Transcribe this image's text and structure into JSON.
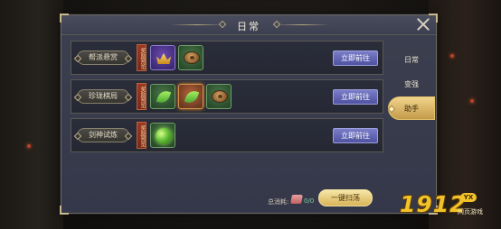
{
  "window": {
    "title": "日常"
  },
  "tabs": [
    {
      "label": "日常",
      "active": false
    },
    {
      "label": "变强",
      "active": false
    },
    {
      "label": "助手",
      "active": true
    }
  ],
  "rows": [
    {
      "label": "帮派悬赏",
      "reward_tag": "奖励预览",
      "items": [
        "crown-icon",
        "coin-icon"
      ],
      "button": "立即前往"
    },
    {
      "label": "珍珑棋局",
      "reward_tag": "奖励预览",
      "items": [
        "leaf-icon",
        "leaf-icon",
        "coin-icon"
      ],
      "button": "立即前往"
    },
    {
      "label": "剑神试炼",
      "reward_tag": "奖励预览",
      "items": [
        "orb-icon"
      ],
      "button": "立即前往"
    }
  ],
  "footer": {
    "cost_label": "总消耗:",
    "cost_value": "0/0",
    "sweep_button": "一键扫荡"
  },
  "watermark": {
    "number": "1912",
    "badge": "YX",
    "subtitle": "网页游戏"
  },
  "colors": {
    "panel": "#3a3d4e",
    "button_purple": "#6266b4",
    "tab_active_gold": "#e0bc6a",
    "logo_gold": "#f2c22a"
  }
}
